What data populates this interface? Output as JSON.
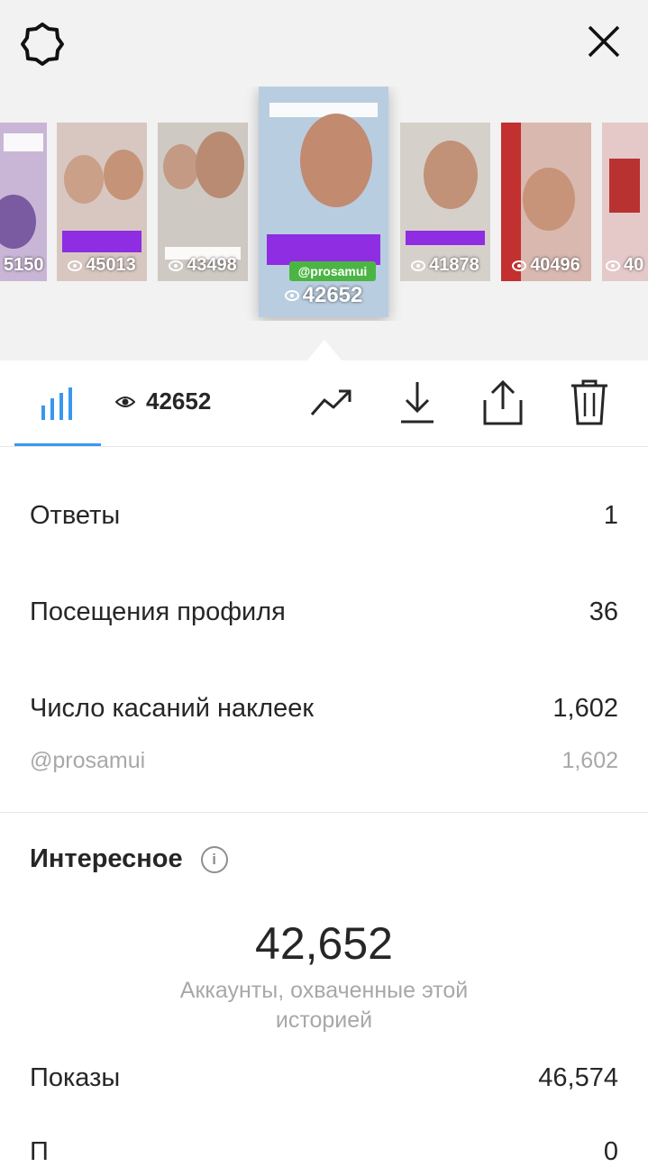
{
  "top": {
    "settings_icon": "gear-icon",
    "close_icon": "close-icon"
  },
  "stories": [
    {
      "count": "5150",
      "bg": "#c9b6d6"
    },
    {
      "count": "45013",
      "bg": "#d8c7c1"
    },
    {
      "count": "43498",
      "bg": "#cfc9c4"
    },
    {
      "count": "42652",
      "bg": "#b9cde0",
      "tag": "@prosamui"
    },
    {
      "count": "41878",
      "bg": "#d6d0cb"
    },
    {
      "count": "40496",
      "bg": "#d9b8b0"
    },
    {
      "count": "40",
      "bg": "#e5c9c9"
    }
  ],
  "toolbar": {
    "views_count": "42652",
    "icons": [
      "bar-chart-icon",
      "eye-icon",
      "trending-icon",
      "download-icon",
      "share-icon",
      "trash-icon"
    ],
    "accent": "#3897f0"
  },
  "stats": {
    "replies": {
      "label": "Ответы",
      "value": "1"
    },
    "profile_visits": {
      "label": "Посещения профиля",
      "value": "36"
    },
    "sticker_taps": {
      "label": "Число касаний наклеек",
      "value": "1,602"
    },
    "sticker_handle": {
      "label": "@prosamui",
      "value": "1,602"
    }
  },
  "discovery": {
    "title": "Интересное",
    "reach_value": "42,652",
    "reach_label": "Аккаунты, охваченные этой историей",
    "impressions": {
      "label": "Показы",
      "value": "46,574"
    },
    "next": {
      "label": "П",
      "value": "0"
    }
  }
}
